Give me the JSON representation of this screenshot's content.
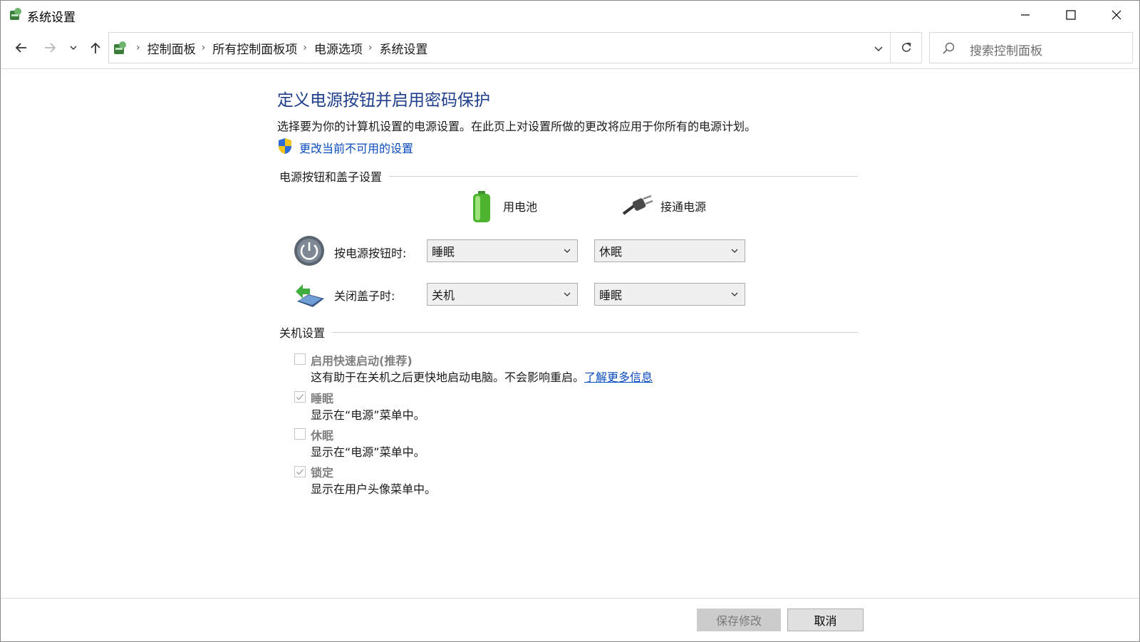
{
  "window": {
    "title": "系统设置"
  },
  "breadcrumb": [
    "控制面板",
    "所有控制面板项",
    "电源选项",
    "系统设置"
  ],
  "search": {
    "placeholder": "搜索控制面板"
  },
  "main": {
    "heading": "定义电源按钮并启用密码保护",
    "description": "选择要为你的计算机设置的电源设置。在此页上对设置所做的更改将应用于你所有的电源计划。",
    "change_link": "更改当前不可用的设置"
  },
  "power_section": {
    "title": "电源按钮和盖子设置",
    "col_battery": "用电池",
    "col_plugged": "接通电源",
    "rows": [
      {
        "label": "按电源按钮时:",
        "battery": "睡眠",
        "plugged": "休眠"
      },
      {
        "label": "关闭盖子时:",
        "battery": "关机",
        "plugged": "睡眠"
      }
    ]
  },
  "shutdown_section": {
    "title": "关机设置",
    "options": [
      {
        "title": "启用快速启动(推荐)",
        "desc": "这有助于在关机之后更快地启动电脑。不会影响重启。",
        "link": "了解更多信息",
        "checked": false
      },
      {
        "title": "睡眠",
        "desc": "显示在“电源”菜单中。",
        "checked": true
      },
      {
        "title": "休眠",
        "desc": "显示在“电源”菜单中。",
        "checked": false
      },
      {
        "title": "锁定",
        "desc": "显示在用户头像菜单中。",
        "checked": true
      }
    ]
  },
  "footer": {
    "save": "保存修改",
    "cancel": "取消"
  }
}
